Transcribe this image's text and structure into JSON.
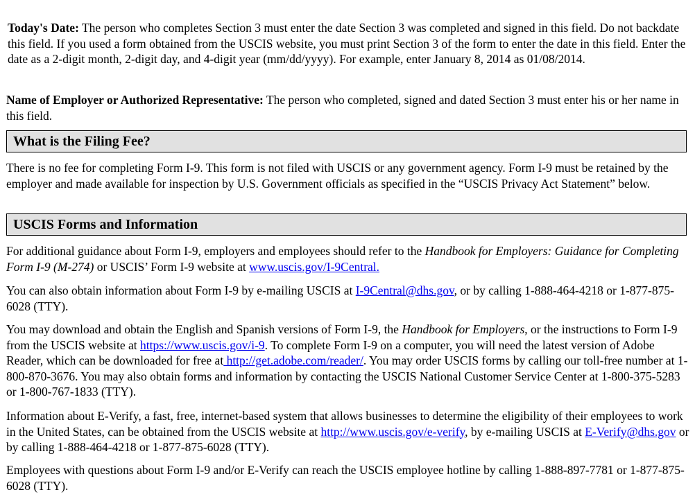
{
  "todays_date": {
    "label": "Today's Date:",
    "text": " The person who completes Section 3 must enter the date Section 3 was completed and signed in this field. Do not backdate this field. If you used a form obtained from the USCIS website, you must print Section 3 of the form to enter the date in this field. Enter the date as a 2-digit month, 2-digit day, and 4-digit year (mm/dd/yyyy). For example, enter January 8, 2014 as 01/08/2014."
  },
  "employer_name": {
    "label": "Name of Employer or Authorized Representative:",
    "text": " The person who completed, signed and dated Section 3 must enter his or her name in this field."
  },
  "filing_fee": {
    "heading": "What is the Filing Fee?",
    "text": "There is no fee for completing Form I-9. This form is not filed with USCIS or any government agency. Form I-9 must be retained by the employer and made available for inspection by U.S. Government officials as specified in the “USCIS Privacy Act Statement” below."
  },
  "forms_info": {
    "heading": "USCIS Forms and Information",
    "p1": {
      "t1": "For additional guidance about Form I-9, employers and employees should refer to the ",
      "italic": "Handbook for Employers: Guidance for Completing Form I-9 (M-274)",
      "t2": " or USCIS’ Form I-9 website at ",
      "link": "www.uscis.gov/I-9Central.",
      "t3": ""
    },
    "p2": {
      "t1": "You can also obtain information about Form I-9 by e-mailing USCIS at ",
      "link": "I-9Central@dhs.gov",
      "t2": ", or by calling 1-888-464-4218 or 1-877-875-6028 (TTY)."
    },
    "p3": {
      "t1": "You may download and obtain the English and Spanish versions of Form I-9, the ",
      "italic": "Handbook for Employers",
      "t2": ", or the instructions to Form I-9 from the USCIS website at ",
      "link1": "https://www.uscis.gov/i-9",
      "t3": ". To complete Form I-9 on a computer, you will need the latest version of Adobe Reader, which can be downloaded for free at",
      "link2": " http://get.adobe.com/reader/",
      "t4": ". You may order USCIS forms by calling our toll-free number at 1-800-870-3676. You may also obtain forms and information by contacting the USCIS National Customer Service Center at 1-800-375-5283 or 1-800-767-1833 (TTY)."
    },
    "p4": {
      "t1": "Information about E-Verify, a fast, free, internet-based system that allows businesses to determine the eligibility of their employees to work in the United States, can be obtained from the USCIS website at ",
      "link1": "http://www.uscis.gov/e-verify",
      "t2": ", by e-mailing USCIS at ",
      "link2": "E-Verify@dhs.gov",
      "t3": " or by calling 1-888-464-4218 or 1-877-875-6028 (TTY)."
    },
    "p5": {
      "text": "Employees with questions about Form I-9 and/or E-Verify can reach the USCIS employee hotline by calling 1-888-897-7781 or 1-877-875-6028 (TTY)."
    }
  }
}
